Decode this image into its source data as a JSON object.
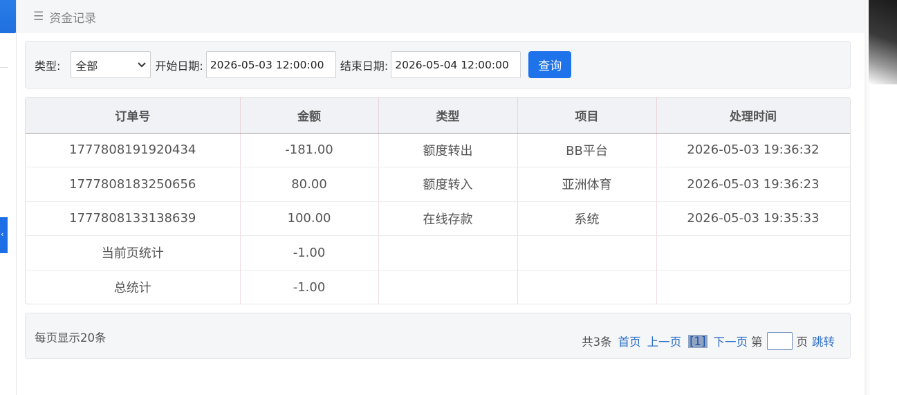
{
  "header": {
    "title": "资金记录"
  },
  "filter": {
    "type_label": "类型:",
    "type_value": "全部",
    "start_label": "开始日期:",
    "start_value": "2026-05-03 12:00:00",
    "end_label": "结束日期:",
    "end_value": "2026-05-04 12:00:00",
    "query_button": "查询"
  },
  "table": {
    "columns": [
      "订单号",
      "金额",
      "类型",
      "项目",
      "处理时间"
    ],
    "rows": [
      [
        "1777808191920434",
        "-181.00",
        "额度转出",
        "BB平台",
        "2026-05-03 19:36:32"
      ],
      [
        "1777808183250656",
        "80.00",
        "额度转入",
        "亚洲体育",
        "2026-05-03 19:36:23"
      ],
      [
        "1777808133138639",
        "100.00",
        "在线存款",
        "系统",
        "2026-05-03 19:35:33"
      ]
    ],
    "page_total": {
      "label": "当前页统计",
      "amount": "-1.00"
    },
    "grand_total": {
      "label": "总统计",
      "amount": "-1.00"
    }
  },
  "pager": {
    "per_page": "每页显示20条",
    "total": "共3条",
    "first": "首页",
    "prev": "上一页",
    "current": "[1]",
    "next": "下一页",
    "page_prefix": "第",
    "page_suffix": "页",
    "jump": "跳转"
  }
}
